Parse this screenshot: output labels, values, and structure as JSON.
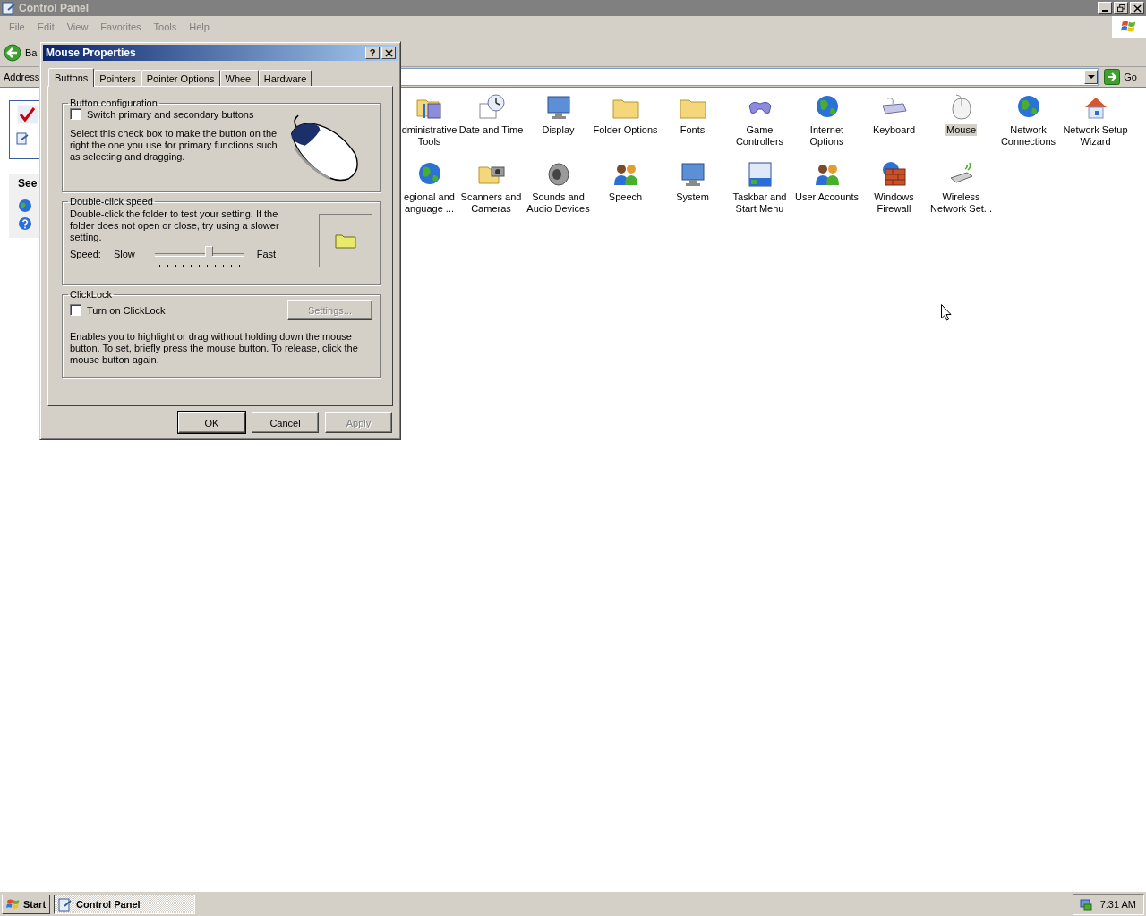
{
  "window": {
    "title": "Control Panel"
  },
  "menu": [
    "File",
    "Edit",
    "View",
    "Favorites",
    "Tools",
    "Help"
  ],
  "toolbar": {
    "back_label": "Ba"
  },
  "address_bar": {
    "label": "Address",
    "go": "Go"
  },
  "left_pane": {
    "section_title": "See"
  },
  "items": [
    {
      "label": "dministrative\nTools",
      "selected": false
    },
    {
      "label": "Date and Time",
      "selected": false
    },
    {
      "label": "Display",
      "selected": false
    },
    {
      "label": "Folder Options",
      "selected": false
    },
    {
      "label": "Fonts",
      "selected": false
    },
    {
      "label": "Game\nControllers",
      "selected": false
    },
    {
      "label": "Internet\nOptions",
      "selected": false
    },
    {
      "label": "Keyboard",
      "selected": false
    },
    {
      "label": "Mouse",
      "selected": true
    },
    {
      "label": "Network\nConnections",
      "selected": false
    },
    {
      "label": "Network Setup\nWizard",
      "selected": false
    },
    {
      "label": "egional and\nanguage ...",
      "selected": false
    },
    {
      "label": "Scanners and\nCameras",
      "selected": false
    },
    {
      "label": "Sounds and\nAudio Devices",
      "selected": false
    },
    {
      "label": "Speech",
      "selected": false
    },
    {
      "label": "System",
      "selected": false
    },
    {
      "label": "Taskbar and\nStart Menu",
      "selected": false
    },
    {
      "label": "User Accounts",
      "selected": false
    },
    {
      "label": "Windows\nFirewall",
      "selected": false
    },
    {
      "label": "Wireless\nNetwork Set...",
      "selected": false
    }
  ],
  "dialog": {
    "title": "Mouse Properties",
    "help": "?",
    "tabs": [
      {
        "label": "Buttons",
        "selected": true
      },
      {
        "label": "Pointers",
        "selected": false
      },
      {
        "label": "Pointer Options",
        "selected": false
      },
      {
        "label": "Wheel",
        "selected": false
      },
      {
        "label": "Hardware",
        "selected": false
      }
    ],
    "button_config": {
      "title": "Button configuration",
      "checkbox": {
        "label": "Switch primary and secondary buttons",
        "checked": false
      },
      "description": "Select this check box to make the button on the right the one you use for primary functions such as selecting and dragging."
    },
    "double_click": {
      "title": "Double-click speed",
      "description": "Double-click the folder to test your setting. If the folder does not open or close, try using a slower setting.",
      "speed_label": "Speed:",
      "slow": "Slow",
      "fast": "Fast",
      "level": 0.6
    },
    "clicklock": {
      "title": "ClickLock",
      "checkbox": {
        "label": "Turn on ClickLock",
        "checked": false
      },
      "settings_button": {
        "label": "Settings...",
        "disabled": true
      },
      "description": "Enables you to highlight or drag without holding down the mouse button. To set, briefly press the mouse button. To release, click the mouse button again."
    },
    "buttons": [
      {
        "label": "OK",
        "disabled": false,
        "default": true
      },
      {
        "label": "Cancel",
        "disabled": false,
        "default": false
      },
      {
        "label": "Apply",
        "disabled": true,
        "default": false
      }
    ]
  },
  "taskbar": {
    "start": "Start",
    "tasks": [
      {
        "label": "Control Panel",
        "selected": true
      }
    ],
    "clock": "7:31 AM"
  }
}
